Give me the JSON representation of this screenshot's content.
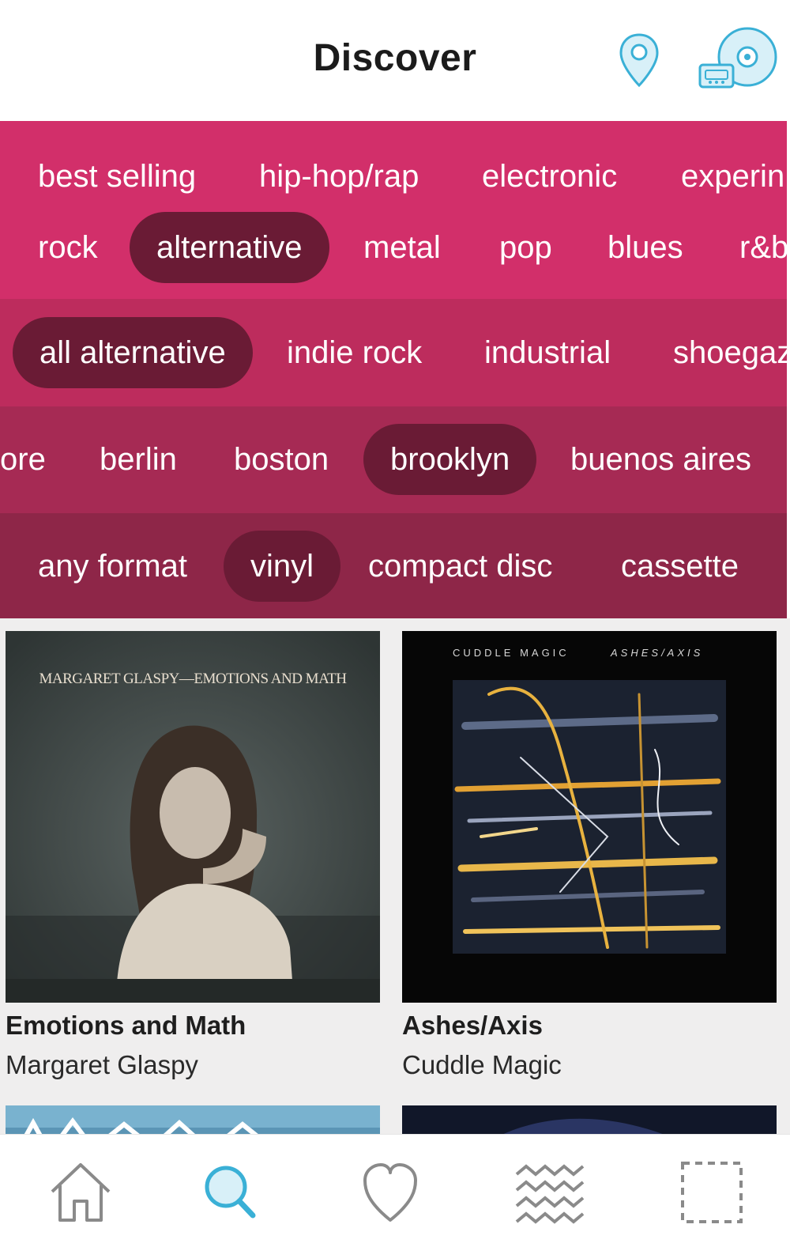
{
  "header": {
    "title": "Discover",
    "location_icon": "map-pin-icon",
    "collection_icon": "cassette-cd-icon"
  },
  "colors": {
    "accent": "#d22f6a",
    "chip_selected": "#6a1b35",
    "icon_blue": "#3ab0d6"
  },
  "filters": {
    "tags_row1": [
      "best selling",
      "hip-hop/rap",
      "electronic",
      "experin"
    ],
    "tags_row2": [
      "rock",
      "alternative",
      "metal",
      "pop",
      "blues",
      "r&b"
    ],
    "subgenres": [
      "all alternative",
      "indie rock",
      "industrial",
      "shoegaz"
    ],
    "locations": [
      "ore",
      "berlin",
      "boston",
      "brooklyn",
      "buenos aires"
    ],
    "formats": [
      "any format",
      "vinyl",
      "compact disc",
      "cassette"
    ],
    "selected": {
      "genre": "alternative",
      "subgenre": "all alternative",
      "location": "brooklyn",
      "format": "vinyl"
    }
  },
  "albums": [
    {
      "title": "Emotions and Math",
      "artist": "Margaret Glaspy",
      "cover_text": "MARGARET GLASPY—EMOTIONS AND MATH"
    },
    {
      "title": "Ashes/Axis",
      "artist": "Cuddle Magic",
      "cover_text_left": "CUDDLE MAGIC",
      "cover_text_right": "ASHES/AXIS"
    }
  ],
  "bottom_nav": {
    "items": [
      "home-icon",
      "search-icon",
      "heart-icon",
      "waves-icon",
      "square-dashed-icon"
    ],
    "active": "search-icon"
  }
}
